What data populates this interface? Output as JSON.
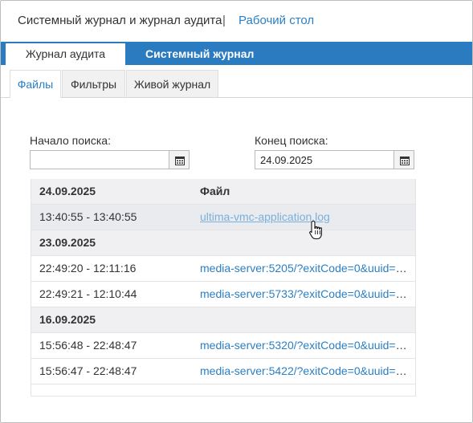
{
  "header": {
    "title": "Системный журнал и журнал аудита",
    "separator": "|",
    "desktop_link": "Рабочий стол"
  },
  "main_tabs": [
    {
      "label": "Журнал аудита",
      "active": true
    },
    {
      "label": "Системный журнал",
      "active": false
    }
  ],
  "sub_tabs": [
    {
      "label": "Файлы",
      "active": true
    },
    {
      "label": "Фильтры",
      "active": false
    },
    {
      "label": "Живой журнал",
      "active": false
    }
  ],
  "search": {
    "start_label": "Начало поиска:",
    "start_value": "",
    "end_label": "Конец поиска:",
    "end_value": "24.09.2025"
  },
  "icons": {
    "calendar": "calendar-icon",
    "cursor": "hand-pointer-cursor"
  },
  "colors": {
    "accent": "#2a7bc0",
    "link": "#2a7fc4",
    "link_hover": "#7ab0db",
    "group_bg": "#f0f0f2"
  },
  "table": {
    "header_date": "24.09.2025",
    "header_file": "Файл",
    "rows": [
      {
        "time": "13:40:55 - 13:40:55",
        "file": "ultima-vmc-application.log"
      },
      {
        "group": "23.09.2025"
      },
      {
        "time": "22:49:20 - 12:11:16",
        "file": "media-server:5205/?exitCode=0&uuid=e..."
      },
      {
        "time": "22:49:21 - 12:10:44",
        "file": "media-server:5733/?exitCode=0&uuid=2..."
      },
      {
        "group": "16.09.2025"
      },
      {
        "time": "15:56:48 - 22:48:47",
        "file": "media-server:5320/?exitCode=0&uuid=b..."
      },
      {
        "time": "15:56:47 - 22:48:47",
        "file": "media-server:5422/?exitCode=0&uuid=e..."
      }
    ]
  }
}
